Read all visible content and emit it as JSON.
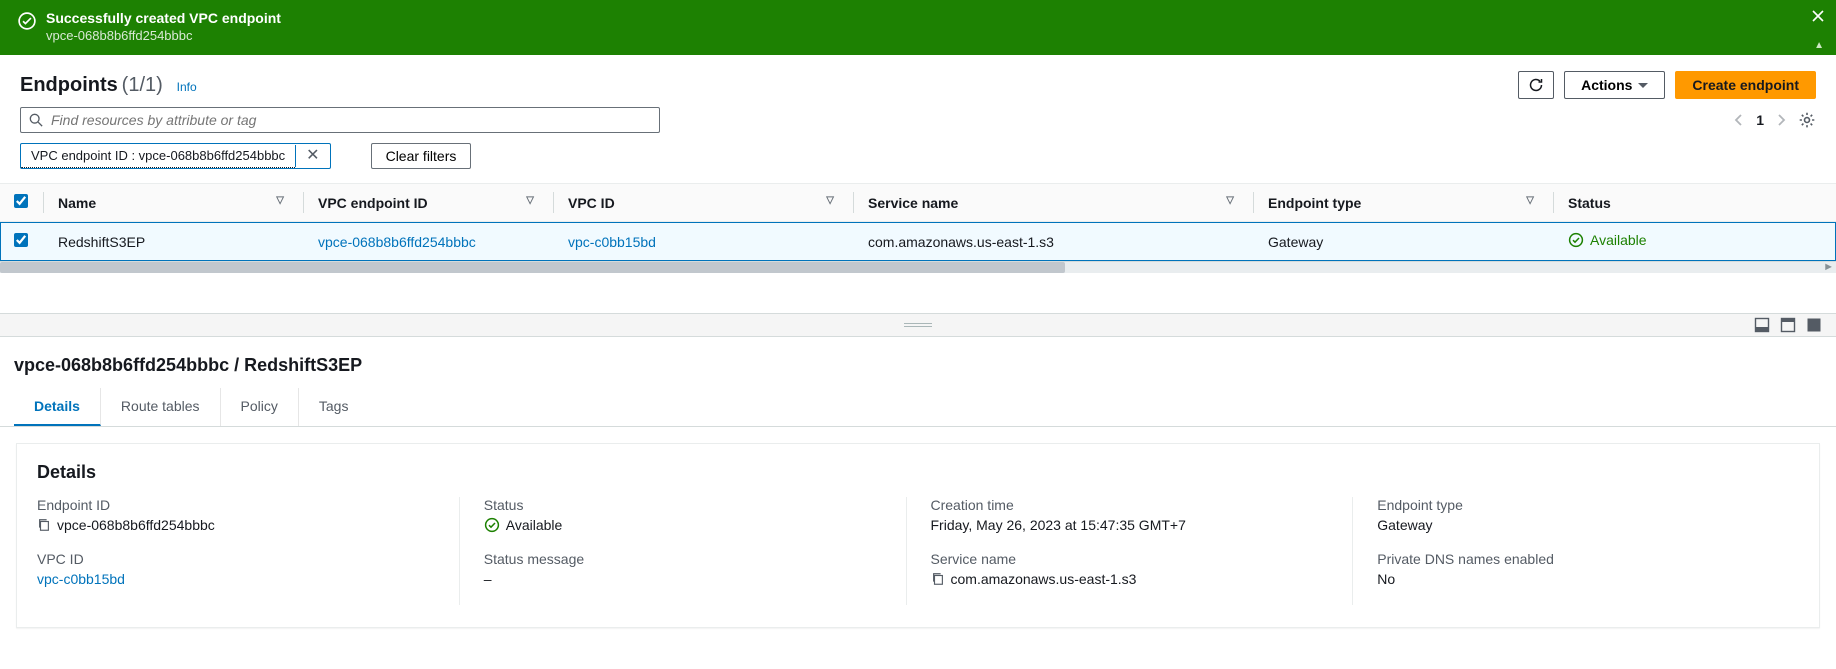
{
  "banner": {
    "title": "Successfully created VPC endpoint",
    "subtitle": "vpce-068b8b6ffd254bbbc"
  },
  "header": {
    "title": "Endpoints",
    "count": "(1/1)",
    "info": "Info",
    "actions_label": "Actions",
    "create_label": "Create endpoint"
  },
  "search": {
    "placeholder": "Find resources by attribute or tag"
  },
  "pager": {
    "page": "1"
  },
  "filter_chip": {
    "label": "VPC endpoint ID : vpce-068b8b6ffd254bbbc"
  },
  "clear_filters": "Clear filters",
  "columns": {
    "name": "Name",
    "vpce_id": "VPC endpoint ID",
    "vpc_id": "VPC ID",
    "service": "Service name",
    "type": "Endpoint type",
    "status": "Status"
  },
  "rows": [
    {
      "name": "RedshiftS3EP",
      "vpce_id": "vpce-068b8b6ffd254bbbc",
      "vpc_id": "vpc-c0bb15bd",
      "service": "com.amazonaws.us-east-1.s3",
      "type": "Gateway",
      "status": "Available"
    }
  ],
  "detail": {
    "breadcrumb": "vpce-068b8b6ffd254bbbc / RedshiftS3EP",
    "tabs": {
      "details": "Details",
      "route": "Route tables",
      "policy": "Policy",
      "tags": "Tags"
    },
    "card_title": "Details",
    "endpoint_id_label": "Endpoint ID",
    "endpoint_id": "vpce-068b8b6ffd254bbbc",
    "vpc_id_label": "VPC ID",
    "vpc_id": "vpc-c0bb15bd",
    "status_label": "Status",
    "status": "Available",
    "status_msg_label": "Status message",
    "status_msg": "–",
    "creation_label": "Creation time",
    "creation": "Friday, May 26, 2023 at 15:47:35 GMT+7",
    "service_label": "Service name",
    "service": "com.amazonaws.us-east-1.s3",
    "type_label": "Endpoint type",
    "type": "Gateway",
    "dns_label": "Private DNS names enabled",
    "dns": "No"
  }
}
